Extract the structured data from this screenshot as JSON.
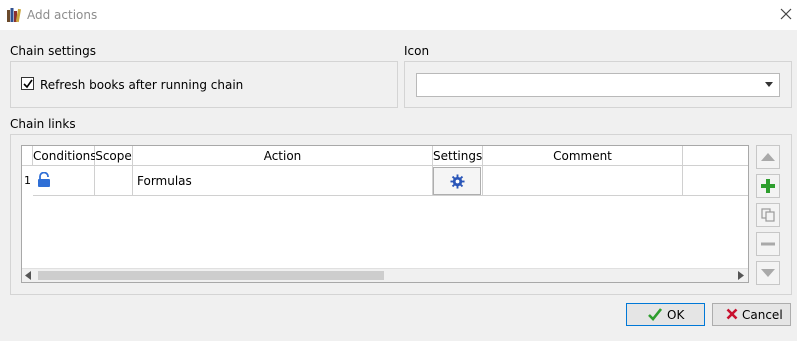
{
  "window": {
    "title": "Add actions",
    "app_icon": "books-icon",
    "close_icon": "close-icon"
  },
  "chain_settings": {
    "title": "Chain settings",
    "refresh_checkbox": {
      "label": "Refresh books after running chain",
      "checked": true
    }
  },
  "icon_section": {
    "title": "Icon",
    "selected": ""
  },
  "chain_links": {
    "title": "Chain links",
    "columns": [
      "Conditions",
      "Scope",
      "Action",
      "Settings",
      "Comment"
    ],
    "rows": [
      {
        "row_number": "1",
        "conditions_icon": "lock-icon",
        "scope": "",
        "action": "Formulas",
        "settings_icon": "gear-icon",
        "comment": ""
      }
    ],
    "side_buttons": [
      "move-up",
      "add",
      "copy",
      "remove",
      "move-down"
    ]
  },
  "buttons": {
    "ok": "OK",
    "cancel": "Cancel"
  },
  "colors": {
    "accent": "#0078d7",
    "add_green": "#2e9e2e",
    "lock_blue": "#2f6fd6",
    "cancel_red": "#c8102e"
  }
}
